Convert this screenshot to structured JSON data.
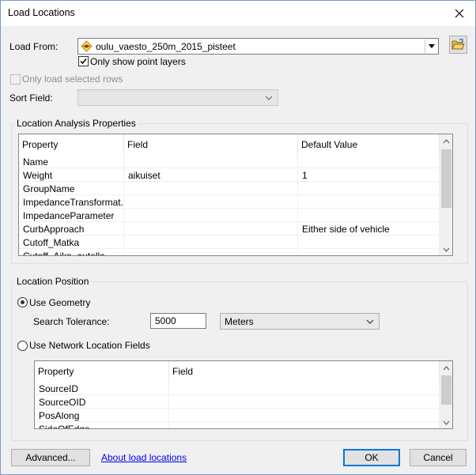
{
  "window": {
    "title": "Load Locations"
  },
  "load_from": {
    "label": "Load From:",
    "value": "oulu_vaesto_250m_2015_pisteet",
    "only_point_layers_label": "Only show point layers",
    "only_point_layers_checked": true
  },
  "only_selected_rows": {
    "label": "Only load selected rows",
    "checked": false,
    "enabled": false
  },
  "sort_field": {
    "label": "Sort Field:",
    "value": ""
  },
  "analysis_props": {
    "title": "Location Analysis Properties",
    "headers": [
      "Property",
      "Field",
      "Default Value"
    ],
    "rows": [
      [
        "Name",
        "",
        ""
      ],
      [
        "Weight",
        "aikuiset",
        "1"
      ],
      [
        "GroupName",
        "",
        ""
      ],
      [
        "ImpedanceTransformat...",
        "",
        ""
      ],
      [
        "ImpedanceParameter",
        "",
        ""
      ],
      [
        "CurbApproach",
        "",
        "Either side of vehicle"
      ],
      [
        "Cutoff_Matka",
        "",
        ""
      ],
      [
        "Cutoff_Aika_autolla",
        "",
        ""
      ]
    ]
  },
  "location_position": {
    "title": "Location Position",
    "use_geometry_label": "Use Geometry",
    "use_geometry_selected": true,
    "search_tolerance_label": "Search Tolerance:",
    "search_tolerance_value": "5000",
    "units_value": "Meters",
    "use_network_fields_label": "Use Network Location Fields",
    "use_network_fields_selected": false,
    "headers": [
      "Property",
      "Field"
    ],
    "rows": [
      [
        "SourceID",
        ""
      ],
      [
        "SourceOID",
        ""
      ],
      [
        "PosAlong",
        ""
      ],
      [
        "SideOfEdge",
        ""
      ]
    ]
  },
  "buttons": {
    "advanced": "Advanced...",
    "about_link": "About load locations",
    "ok": "OK",
    "cancel": "Cancel"
  },
  "icons": {
    "close": "close-icon",
    "layer": "point-layer-icon",
    "browse": "open-folder-icon",
    "chevron": "chevron-down-icon"
  }
}
